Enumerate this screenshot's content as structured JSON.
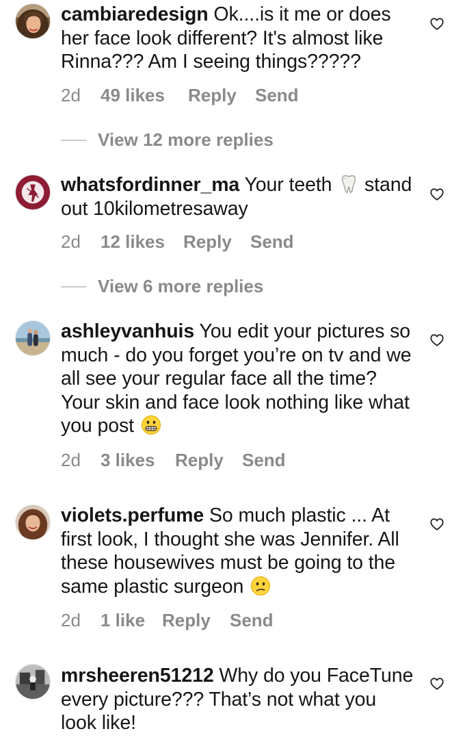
{
  "comments": [
    {
      "username": "cambiaredesign",
      "text": " Ok....is it me or does her face look different? It's almost like Rinna??? Am I seeing things?????",
      "time": "2d",
      "likes": "49 likes",
      "reply": "Reply",
      "send": "Send",
      "view_replies": "View 12 more replies"
    },
    {
      "username": "whatsfordinner_ma",
      "text_before": " Your teeth ",
      "emoji": "tooth-emoji",
      "text_after": " stand out 10kilometresaway",
      "time": "2d",
      "likes": "12 likes",
      "reply": "Reply",
      "send": "Send",
      "view_replies": "View 6 more replies"
    },
    {
      "username": "ashleyvanhuis",
      "text": " You edit your pictures so much - do you forget you’re on tv and we all see your regular face all the time? Your skin and face look nothing like what you post ",
      "emoji": "grimacing-face-emoji",
      "time": "2d",
      "likes": "3 likes",
      "reply": "Reply",
      "send": "Send"
    },
    {
      "username": "violets.perfume",
      "text": " So much plastic ... At first look, I thought she was Jennifer. All these housewives must be going to the same plastic surgeon ",
      "emoji": "confused-face-emoji",
      "time": "2d",
      "likes": "1 like",
      "reply": "Reply",
      "send": "Send"
    },
    {
      "username": "mrsheeren51212",
      "text": " Why do you FaceTune every picture??? That’s not what you look like!"
    }
  ],
  "colors": {
    "text": "#161616",
    "meta": "#8a8a8a",
    "divider": "#c9c9c9"
  },
  "icons": {
    "like": "heart-outline-icon"
  }
}
